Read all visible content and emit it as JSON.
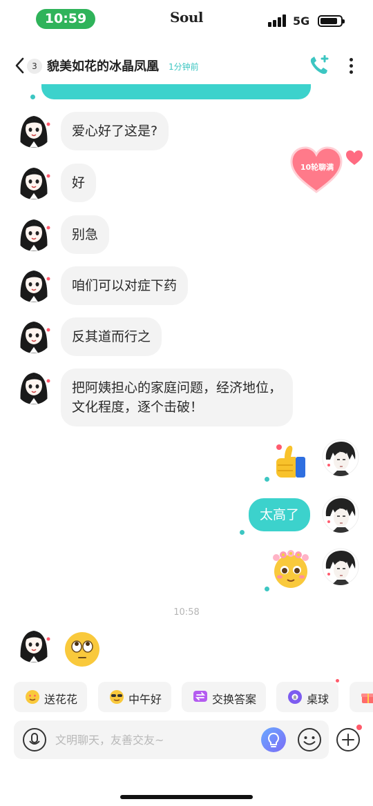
{
  "status_bar": {
    "time": "10:59",
    "carrier": "Soul",
    "network": "5G"
  },
  "header": {
    "unread_count": "3",
    "title": "貌美如花的冰晶凤凰",
    "last_seen": "1分钟前",
    "icons": {
      "back": "chevron-left-icon",
      "call": "phone-video-icon",
      "more": "more-vertical-icon"
    }
  },
  "floating_badge": {
    "label": "10轮聊满",
    "color": "#ff6b81"
  },
  "messages": [
    {
      "side": "in",
      "text": "爱心好了这是?"
    },
    {
      "side": "in",
      "text": "好"
    },
    {
      "side": "in",
      "text": "别急"
    },
    {
      "side": "in",
      "text": "咱们可以对症下药"
    },
    {
      "side": "in",
      "text": "反其道而行之"
    },
    {
      "side": "in",
      "text": "把阿姨担心的家庭问题，经济地位，",
      "text2": "文化程度，逐个击破！"
    },
    {
      "side": "out",
      "kind": "sticker",
      "icon": "thumbs-up-icon"
    },
    {
      "side": "out",
      "text": "太高了"
    },
    {
      "side": "out",
      "kind": "sticker",
      "icon": "flower-crown-emoji-icon"
    },
    {
      "side": "in",
      "kind": "sticker",
      "icon": "rolling-eyes-emoji-icon"
    }
  ],
  "timestamp": "10:58",
  "quick_replies": [
    {
      "label": "送花花",
      "icon": "heart-eyes-emoji-icon"
    },
    {
      "label": "中午好",
      "icon": "sunglasses-emoji-icon"
    },
    {
      "label": "交换答案",
      "icon": "exchange-icon"
    },
    {
      "label": "桌球",
      "icon": "billiard-ball-icon"
    },
    {
      "label": "",
      "icon": "gift-icon"
    }
  ],
  "input": {
    "placeholder": "文明聊天，友善交友~"
  },
  "colors": {
    "accent": "#3cd2cc",
    "status_pill": "#2fb35a",
    "incoming_bubble": "#f3f3f3"
  }
}
